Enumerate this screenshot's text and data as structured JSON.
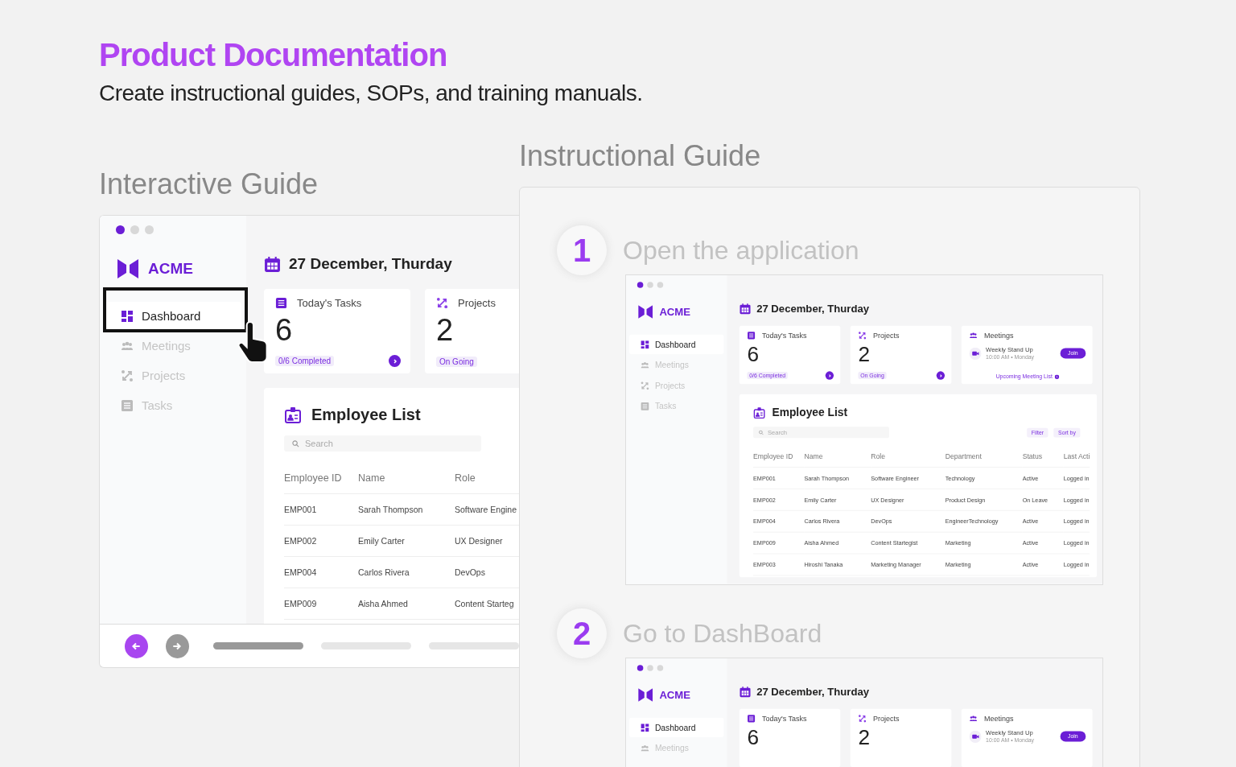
{
  "header": {
    "title": "Product Documentation",
    "subtitle": "Create instructional guides, SOPs, and training manuals."
  },
  "interactive_guide": {
    "heading": "Interactive Guide",
    "screen": {
      "brand": "ACME",
      "sidebar": [
        {
          "label": "Dashboard",
          "selected": true
        },
        {
          "label": "Meetings",
          "selected": false
        },
        {
          "label": "Projects",
          "selected": false
        },
        {
          "label": "Tasks",
          "selected": false
        }
      ],
      "date": "27 December, Thurday",
      "cards": [
        {
          "kind": "count",
          "title": "Today's Tasks",
          "value": "6",
          "badge": "0/6 Completed",
          "arrow": true
        },
        {
          "kind": "count",
          "title": "Projects",
          "value": "2",
          "badge": "On Going",
          "arrow": false
        }
      ],
      "employee_list": {
        "title": "Employee List",
        "search": {
          "placeholder": "Search"
        },
        "columns": [
          "Employee ID",
          "Name",
          "Role"
        ],
        "rows": [
          [
            "EMP001",
            "Sarah Thompson",
            "Software Engine"
          ],
          [
            "EMP002",
            "Emily Carter",
            "UX Designer"
          ],
          [
            "EMP004",
            "Carlos Rivera",
            "DevOps"
          ],
          [
            "EMP009",
            "Aisha Ahmed",
            "Content Starteg"
          ]
        ]
      }
    },
    "nav": {
      "back": {
        "highlighted": true
      },
      "forward": {
        "highlighted": false
      },
      "progress": [
        {
          "selected": true
        },
        {
          "selected": false
        },
        {
          "selected": false
        }
      ]
    }
  },
  "instructional_guide": {
    "heading": "Instructional Guide",
    "steps": [
      {
        "number": "1",
        "title": "Open the application",
        "screen": {
          "brand": "ACME",
          "sidebar": [
            {
              "label": "Dashboard",
              "selected": true
            },
            {
              "label": "Meetings",
              "selected": false
            },
            {
              "label": "Projects",
              "selected": false
            },
            {
              "label": "Tasks",
              "selected": false
            }
          ],
          "date": "27 December, Thurday",
          "cards": [
            {
              "kind": "count",
              "title": "Today's Tasks",
              "value": "6",
              "badge": "0/6 Completed",
              "arrow": true
            },
            {
              "kind": "count",
              "title": "Projects",
              "value": "2",
              "badge": "On Going",
              "arrow": true
            },
            {
              "kind": "meeting",
              "title": "Meetings",
              "meeting": "Weekly Stand Up",
              "time": "10:00 AM • Monday",
              "button": "Join",
              "link": "Upcoming Meeting List"
            }
          ],
          "employee_list": {
            "title": "Employee List",
            "search": {
              "placeholder": "Search"
            },
            "actions": [
              "Filter",
              "Sort by"
            ],
            "columns": [
              "Employee ID",
              "Name",
              "Role",
              "Department",
              "Status",
              "Last Acti"
            ],
            "rows": [
              [
                "EMP001",
                "Sarah Thompson",
                "Software Engineer",
                "Technology",
                "Active",
                "Logged in"
              ],
              [
                "EMP002",
                "Emily Carter",
                "UX Designer",
                "Product Design",
                "On Leave",
                "Logged in"
              ],
              [
                "EMP004",
                "Carlos Rivera",
                "DevOps",
                "EngineerTechnology",
                "Active",
                "Logged in"
              ],
              [
                "EMP009",
                "Aisha Ahmed",
                "Content Startegist",
                "Marketing",
                "Active",
                "Logged in"
              ],
              [
                "EMP003",
                "Hiroshi Tanaka",
                "Marketing Manager",
                "Marketing",
                "Active",
                "Logged in"
              ]
            ]
          }
        }
      },
      {
        "number": "2",
        "title": "Go to DashBoard",
        "screen": {
          "brand": "ACME",
          "sidebar": [
            {
              "label": "Dashboard",
              "selected": true
            },
            {
              "label": "Meetings",
              "selected": false
            }
          ],
          "date": "27 December, Thurday",
          "cards": [
            {
              "kind": "count",
              "title": "Today's Tasks",
              "value": "6",
              "arrow": false
            },
            {
              "kind": "count",
              "title": "Projects",
              "value": "2",
              "arrow": false
            },
            {
              "kind": "meeting",
              "title": "Meetings",
              "meeting": "Weekly Stand Up",
              "time": "10:00 AM • Monday",
              "button": "Join"
            }
          ]
        }
      }
    ]
  }
}
